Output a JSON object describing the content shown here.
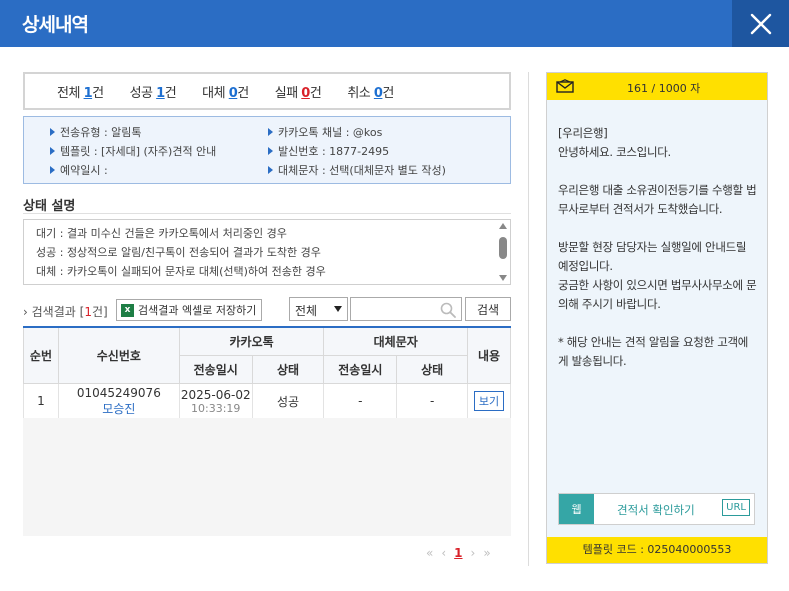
{
  "window": {
    "title": "상세내역"
  },
  "counts": [
    {
      "label": "전체 ",
      "num": "1",
      "suffix": "건"
    },
    {
      "label": "성공 ",
      "num": "1",
      "suffix": "건"
    },
    {
      "label": "대체 ",
      "num": "0",
      "suffix": "건"
    },
    {
      "label": "실패 ",
      "num": "0",
      "suffix": "건"
    },
    {
      "label": "취소 ",
      "num": "0",
      "suffix": "건"
    }
  ],
  "info": {
    "left": [
      "전송유형 : 알림톡",
      "템플릿 : [자세대] (자주)견적 안내",
      "예약일시 :"
    ],
    "right": [
      "카카오톡 채널 : @kos",
      "발신번호 : 1877-2495",
      "대체문자 : 선택(대체문자 별도 작성)"
    ]
  },
  "status": {
    "title": "상태 설명",
    "lines": [
      "대기 : 결과 미수신 건들은 카카오톡에서 처리중인 경우",
      "성공 : 정상적으로 알림/친구톡이 전송되어 결과가 도착한 경우",
      "대체 : 카카오톡이 실패되어 문자로 대체(선택)하여 전송한 경우"
    ]
  },
  "search": {
    "result_label": "검색결과",
    "result_count_open": "[",
    "result_count": "1",
    "result_count_close": "건]",
    "excel_label": "검색결과 엑셀로 저장하기",
    "select_value": "전체",
    "input_value": "",
    "button_label": "검색"
  },
  "table": {
    "headers": {
      "no": "순번",
      "receiver": "수신번호",
      "kakao": "카카오톡",
      "alt": "대체문자",
      "content": "내용",
      "sent_at": "전송일시",
      "state": "상태",
      "alt_sent_at": "전송일시",
      "alt_state": "상태"
    },
    "rows": [
      {
        "no": "1",
        "phone": "01045249076",
        "name": "모승진",
        "date": "2025-06-02",
        "time": "10:33:19",
        "state": "성공",
        "alt_sent": "-",
        "alt_state": "-",
        "view": "보기"
      }
    ]
  },
  "pager": {
    "first": "«",
    "prev": "‹",
    "current": "1",
    "next": "›",
    "last": "»"
  },
  "preview": {
    "counter": "161 / 1000 자",
    "message": "[우리은행]\n안녕하세요. 코스입니다.\n\n우리은행 대출 소유권이전등기를 수행할 법무사로부터 견적서가 도착했습니다.\n\n방문할 현장 담당자는 실행일에 안내드릴 예정입니다.\n궁금한 사항이 있으시면 법무사사무소에 문의해 주시기 바랍니다.\n\n* 해당 안내는 견적 알림을 요청한 고객에게 발송됩니다.",
    "web_label": "웹",
    "button_text": "견적서 확인하기",
    "url_label": "URL",
    "template_code": "템플릿 코드 : 025040000553"
  },
  "colors": {
    "header_blue": "#2b6dc4",
    "accent_yellow": "#ffe000",
    "success_blue": "#2b6dc4",
    "fail_red": "#d9222a",
    "web_teal": "#35a6a6"
  }
}
